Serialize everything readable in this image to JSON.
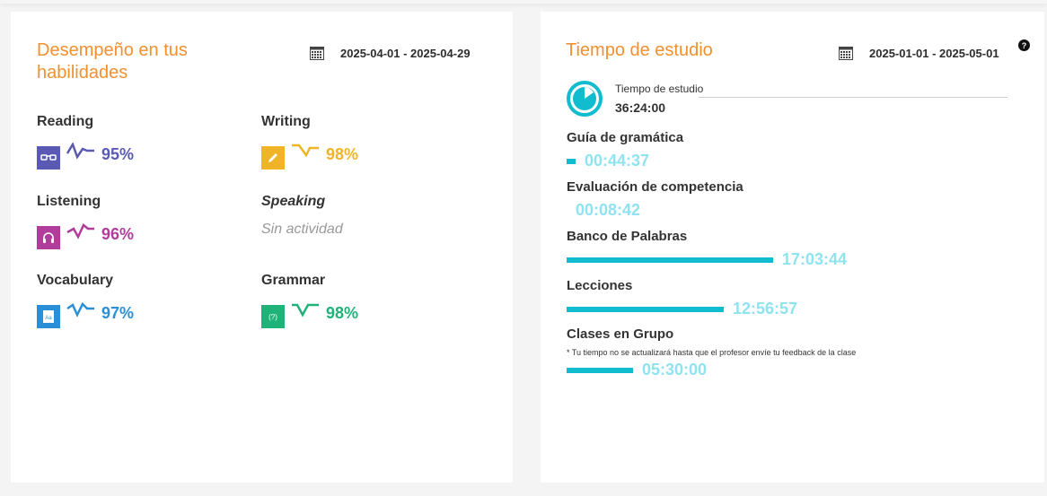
{
  "skills_card": {
    "title_line1": "Desempeño en tus",
    "title_line2": "habilidades",
    "date_range": "2025-04-01 - 2025-04-29",
    "skills": [
      {
        "name": "Reading",
        "percent": "95%",
        "color": "#5a5ab4",
        "icon": "glasses-icon"
      },
      {
        "name": "Writing",
        "percent": "98%",
        "color": "#f0b429",
        "icon": "pencil-icon"
      },
      {
        "name": "Listening",
        "percent": "96%",
        "color": "#b03c9b",
        "icon": "headphones-icon"
      },
      {
        "name": "Speaking",
        "status": "Sin actividad"
      },
      {
        "name": "Vocabulary",
        "percent": "97%",
        "color": "#2b8fd6",
        "icon": "dictionary-icon"
      },
      {
        "name": "Grammar",
        "percent": "98%",
        "color": "#1fb37a",
        "icon": "grammar-icon"
      }
    ]
  },
  "time_card": {
    "title": "Tiempo de estudio",
    "date_range": "2025-01-01 - 2025-05-01",
    "total_label": "Tiempo de estudio",
    "total_value": "36:24:00",
    "bar_color": "#10bccd",
    "time_color": "#8fe3f0",
    "activities": [
      {
        "name": "Guía de gramática",
        "time": "00:44:37",
        "fraction": 0.043
      },
      {
        "name": "Evaluación de competencia",
        "time": "00:08:42",
        "fraction": 0.0
      },
      {
        "name": "Banco de Palabras",
        "time": "17:03:44",
        "fraction": 1.0
      },
      {
        "name": "Lecciones",
        "time": "12:56:57",
        "fraction": 0.759
      },
      {
        "name": "Clases en Grupo",
        "note": "* Tu tiempo no se actualizará hasta que el profesor envíe tu feedback de la clase",
        "time": "05:30:00",
        "fraction": 0.322
      }
    ]
  }
}
